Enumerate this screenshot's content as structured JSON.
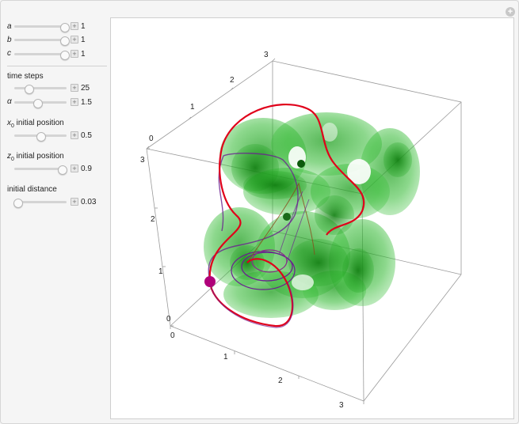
{
  "controls": {
    "a": {
      "label": "a",
      "value": "1",
      "fraction": 0.97
    },
    "b": {
      "label": "b",
      "value": "1",
      "fraction": 0.97
    },
    "c": {
      "label": "c",
      "value": "1",
      "fraction": 0.97
    },
    "time_steps": {
      "label": "time steps",
      "value": "25",
      "fraction": 0.32
    },
    "alpha": {
      "label": "α",
      "value": "1.5",
      "fraction": 0.43
    },
    "x0": {
      "label_var": "x",
      "label_sub": "0",
      "label_rest": " initial position",
      "value": "0.5",
      "fraction": 0.5
    },
    "z0": {
      "label_var": "z",
      "label_sub": "0",
      "label_rest": " initial position",
      "value": "0.9",
      "fraction": 0.9
    },
    "initial_distance": {
      "label": "initial distance",
      "value": "0.03",
      "fraction": 0.06
    }
  },
  "plot": {
    "top_axis_ticks": [
      "0",
      "1",
      "2",
      "3"
    ],
    "left_axis_ticks": [
      "0",
      "1",
      "2",
      "3"
    ],
    "bottom_axis_ticks_front": [
      "0",
      "1",
      "2",
      "3"
    ],
    "colors": {
      "isosurface": "#2fb82f",
      "trajectory_red": "#e0001a",
      "trajectory_purple": "#6a2090"
    }
  }
}
